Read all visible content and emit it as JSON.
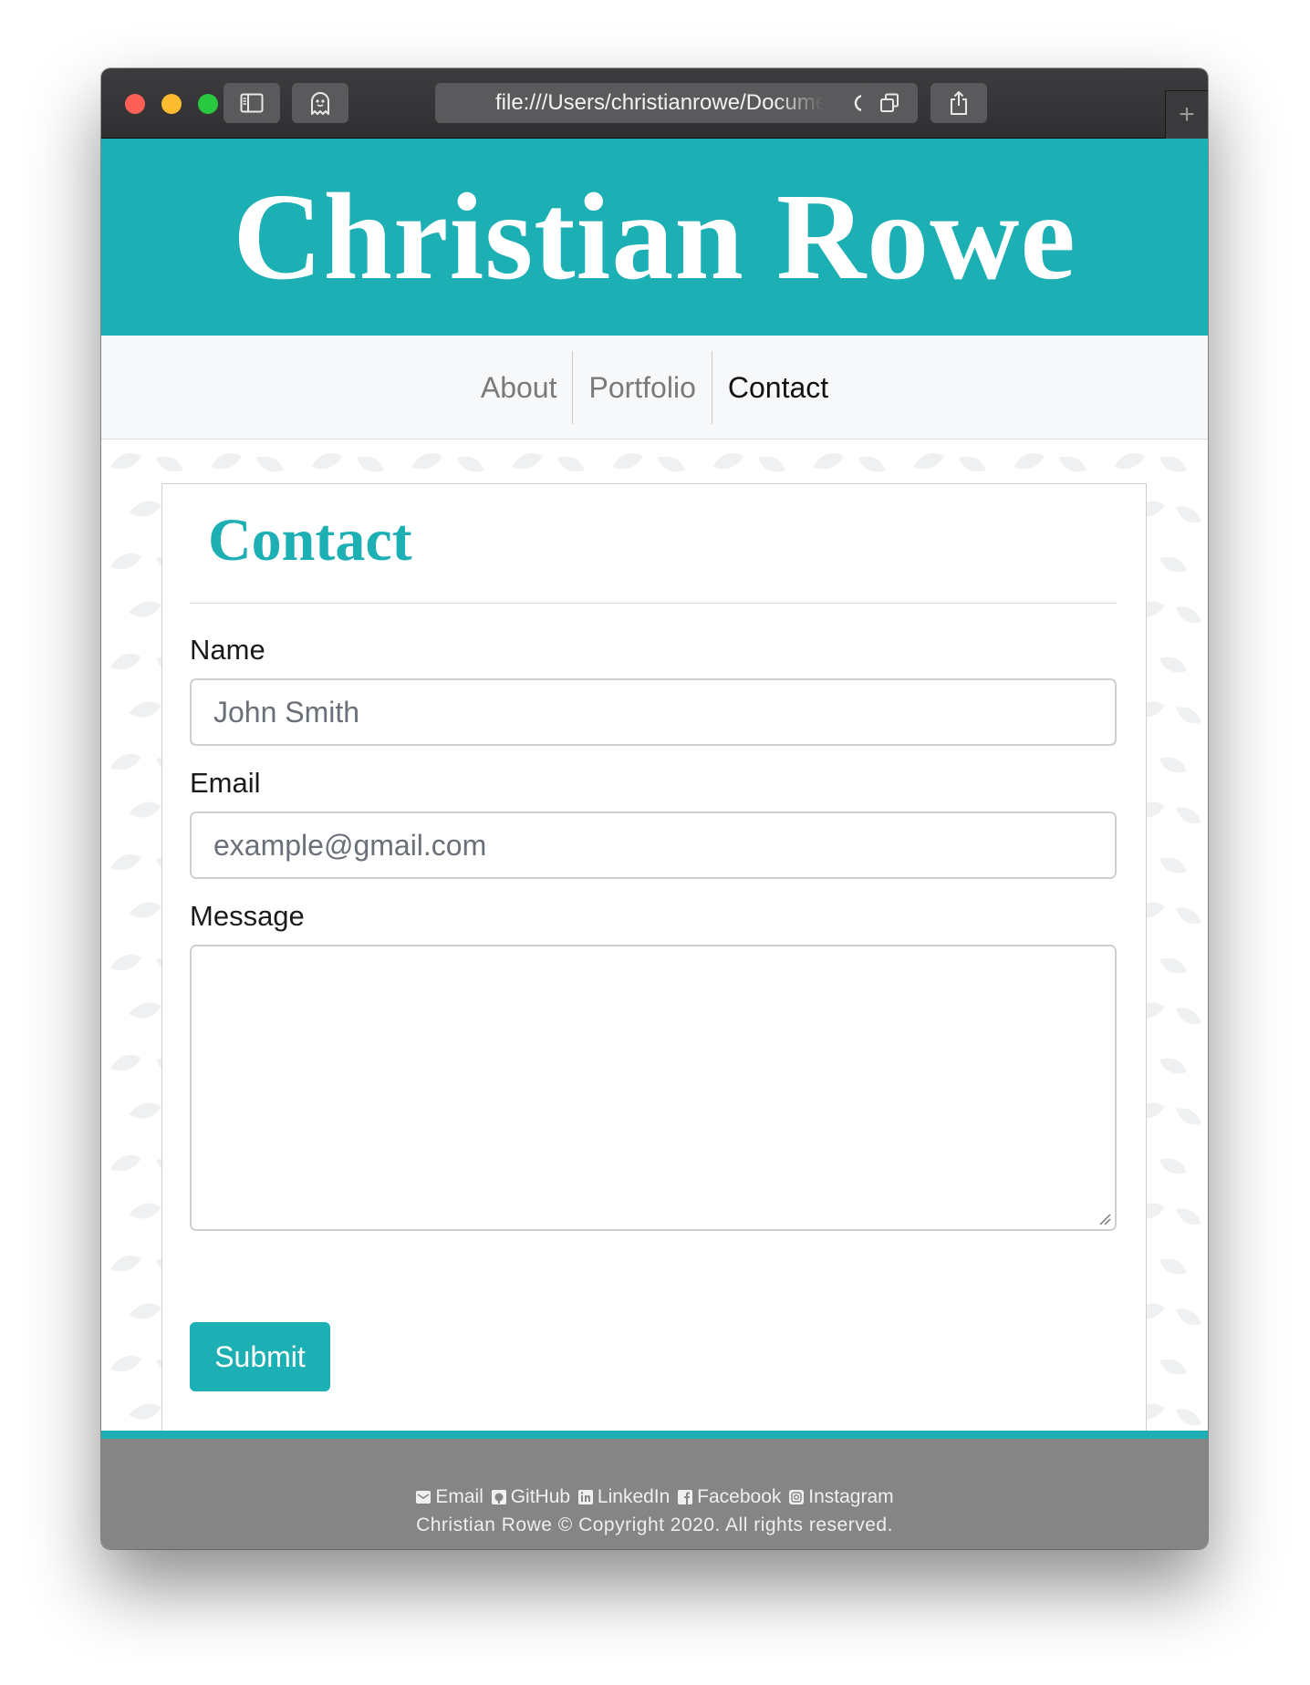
{
  "browser": {
    "url": "file:///Users/christianrowe/Documents",
    "new_tab_symbol": "+",
    "icons": [
      "sidebar-icon",
      "ghost-icon",
      "reload-icon",
      "tabs-overview-icon",
      "share-icon",
      "plus-icon"
    ]
  },
  "site": {
    "title": "Christian Rowe",
    "accent_color": "#1cafb4",
    "footer_color": "#858585"
  },
  "nav": {
    "items": [
      {
        "label": "About",
        "active": false
      },
      {
        "label": "Portfolio",
        "active": false
      },
      {
        "label": "Contact",
        "active": true
      }
    ]
  },
  "contact": {
    "heading": "Contact",
    "name_label": "Name",
    "name_placeholder": "John Smith",
    "email_label": "Email",
    "email_placeholder": "example@gmail.com",
    "message_label": "Message",
    "message_value": "",
    "submit_label": "Submit"
  },
  "footer": {
    "links": [
      {
        "label": "Email",
        "icon": "envelope-icon"
      },
      {
        "label": "GitHub",
        "icon": "github-icon"
      },
      {
        "label": "LinkedIn",
        "icon": "linkedin-icon"
      },
      {
        "label": "Facebook",
        "icon": "facebook-icon"
      },
      {
        "label": "Instagram",
        "icon": "instagram-icon"
      }
    ],
    "copyright": "Christian Rowe © Copyright 2020. All rights reserved."
  }
}
